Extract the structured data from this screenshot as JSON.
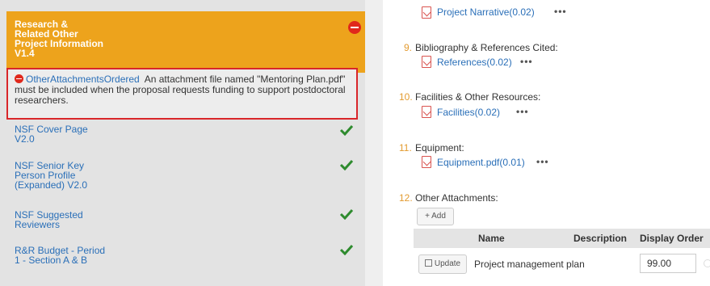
{
  "left_panel": {
    "active_section": {
      "title_lines": [
        "Research &",
        "Related Other",
        "Project Information",
        "V1.4"
      ]
    },
    "error": {
      "link": "OtherAttachmentsOrdered",
      "message": "An attachment file named \"Mentoring Plan.pdf\" must be included when the proposal requests funding to support postdoctoral researchers."
    },
    "items": [
      {
        "lines": [
          "NSF Cover Page",
          "V2.0"
        ]
      },
      {
        "lines": [
          "NSF Senior Key",
          "Person Profile",
          "(Expanded) V2.0"
        ]
      },
      {
        "lines": [
          "NSF Suggested",
          "Reviewers"
        ]
      },
      {
        "lines": [
          "R&R Budget - Period",
          "1 - Section A & B"
        ]
      }
    ],
    "colors": {
      "panel_bg": "#e3e3e3",
      "active_bg": "#eda31c",
      "error_red": "#d9262a",
      "link_blue": "#2a6fb8",
      "check_green": "#2e8b2e"
    }
  },
  "right_panel": {
    "top_file": "Project Narrative(0.02)",
    "requirements": [
      {
        "number": "9.",
        "title": "Bibliography & References Cited:",
        "file": "References(0.02)"
      },
      {
        "number": "10.",
        "title": "Facilities & Other Resources:",
        "file": "Facilities(0.02)"
      },
      {
        "number": "11.",
        "title": "Equipment:",
        "file": "Equipment.pdf(0.01)"
      },
      {
        "number": "12.",
        "title": "Other Attachments:"
      }
    ],
    "more": "•••",
    "add_button": "+ Add",
    "table": {
      "headers": [
        "Name",
        "Description",
        "Display Order"
      ],
      "rows": [
        {
          "action": "Update",
          "name": "Project management plan",
          "display_order": "99.00"
        }
      ]
    }
  }
}
